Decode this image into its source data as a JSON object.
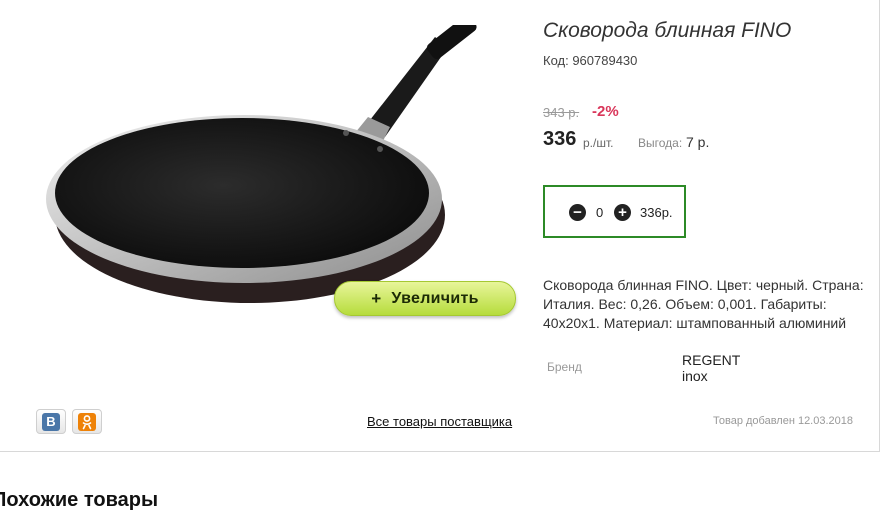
{
  "product": {
    "title": "Сковорода блинная FINO",
    "code_label": "Код: 960789430",
    "old_price": "343 р.",
    "discount": "-2%",
    "price": "336",
    "unit": "р./шт.",
    "benefit_label": "Выгода:",
    "benefit_value": "7 р.",
    "description": "Сковорода блинная FINO. Цвет: черный. Страна: Италия. Вес: 0,26. Объем: 0,001. Габариты: 40х20х1. Материал: штампованный алюминий",
    "brand_label": "Бренд",
    "brand_value": "REGENT inox",
    "added": "Товар добавлен 12.03.2018"
  },
  "cart": {
    "quantity": "0",
    "sum": "336р."
  },
  "zoom": {
    "plus": "+",
    "label": "Увеличить"
  },
  "links": {
    "supplier": "Все товары поставщика"
  },
  "similar": {
    "title": "Похожие товары"
  },
  "social": {
    "vk_letter": "В",
    "ok_icon": "odnoklassniki-icon"
  },
  "colors": {
    "accent_green": "#2c8a26",
    "discount_red": "#d9365a",
    "zoom_button": "#c8e65a"
  }
}
